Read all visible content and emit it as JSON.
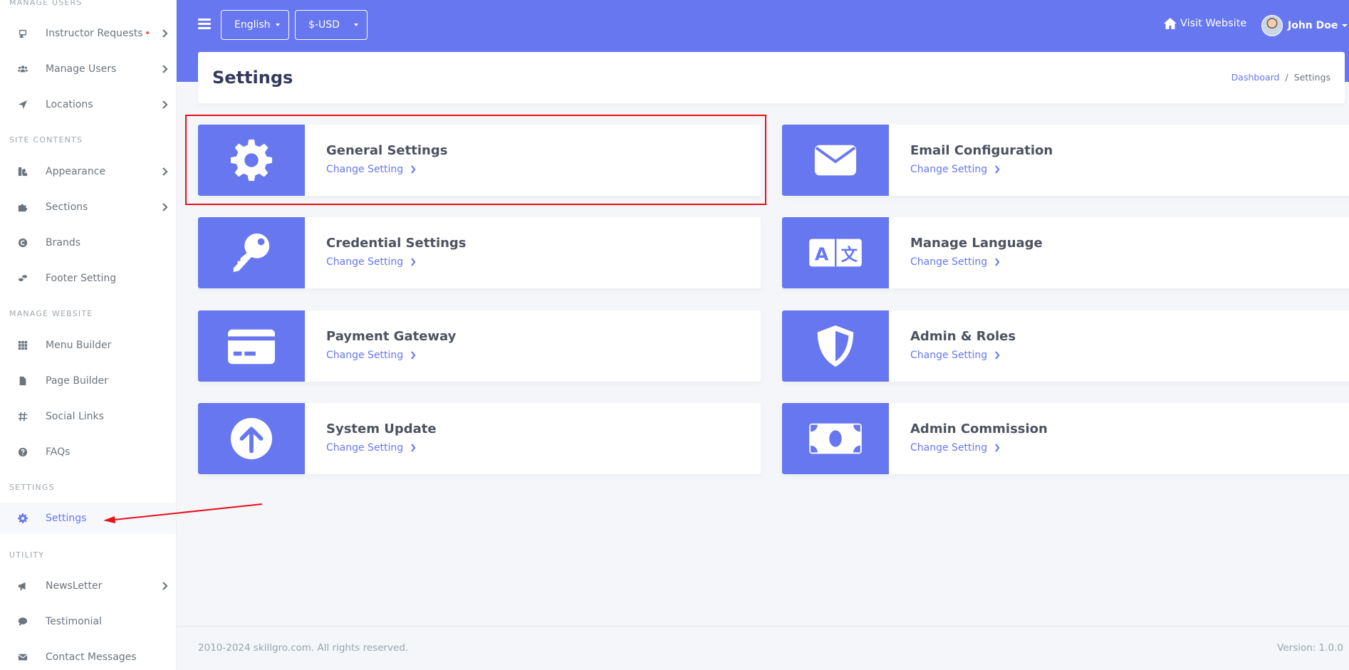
{
  "sidebar": {
    "sections": [
      {
        "header": "Manage Users",
        "items": [
          {
            "label": "Instructor Requests",
            "icon": "user-tie-icon"
          },
          {
            "label": "Manage Users",
            "icon": "users-icon"
          },
          {
            "label": "Locations",
            "icon": "location-arrow-icon"
          }
        ]
      },
      {
        "header": "Site Contents",
        "items": [
          {
            "label": "Appearance",
            "icon": "swatchbook-icon"
          },
          {
            "label": "Sections",
            "icon": "puzzle-icon"
          },
          {
            "label": "Brands",
            "icon": "copyright-icon"
          },
          {
            "label": "Footer Setting",
            "icon": "shoe-prints-icon"
          }
        ]
      },
      {
        "header": "Manage Website",
        "items": [
          {
            "label": "Menu Builder",
            "icon": "grid-icon"
          },
          {
            "label": "Page Builder",
            "icon": "file-icon"
          },
          {
            "label": "Social Links",
            "icon": "hashtag-icon"
          },
          {
            "label": "FAQs",
            "icon": "question-circle-icon"
          }
        ]
      },
      {
        "header": "Settings",
        "items": [
          {
            "label": "Settings",
            "icon": "cog-icon",
            "active": true
          }
        ]
      },
      {
        "header": "Utility",
        "items": [
          {
            "label": "NewsLetter",
            "icon": "bullhorn-icon"
          },
          {
            "label": "Testimonial",
            "icon": "comment-icon"
          },
          {
            "label": "Contact Messages",
            "icon": "envelope-icon"
          }
        ]
      }
    ]
  },
  "topbar": {
    "language": "English",
    "currency": "$-USD",
    "visit_website": "Visit Website",
    "user_name": "John Doe"
  },
  "page": {
    "title": "Settings",
    "breadcrumb": [
      "Dashboard",
      "/",
      "Settings"
    ]
  },
  "cards": [
    {
      "title": "General Settings",
      "cta": "Change Setting",
      "icon": "cog-icon"
    },
    {
      "title": "Email Configuration",
      "cta": "Change Setting",
      "icon": "envelope-icon"
    },
    {
      "title": "Credential Settings",
      "cta": "Change Setting",
      "icon": "key-icon"
    },
    {
      "title": "Manage Language",
      "cta": "Change Setting",
      "icon": "language-icon"
    },
    {
      "title": "Payment Gateway",
      "cta": "Change Setting",
      "icon": "credit-card-icon"
    },
    {
      "title": "Admin & Roles",
      "cta": "Change Setting",
      "icon": "shield-icon"
    },
    {
      "title": "System Update",
      "cta": "Change Setting",
      "icon": "arrow-up-circle-icon"
    },
    {
      "title": "Admin Commission",
      "cta": "Change Setting",
      "icon": "money-bill-icon"
    }
  ],
  "footer": {
    "copyright": "2010-2024 skillgro.com. All rights reserved.",
    "version": "Version: 1.0.0"
  },
  "colors": {
    "primary": "#6777ef",
    "highlight": "#e8101c"
  }
}
